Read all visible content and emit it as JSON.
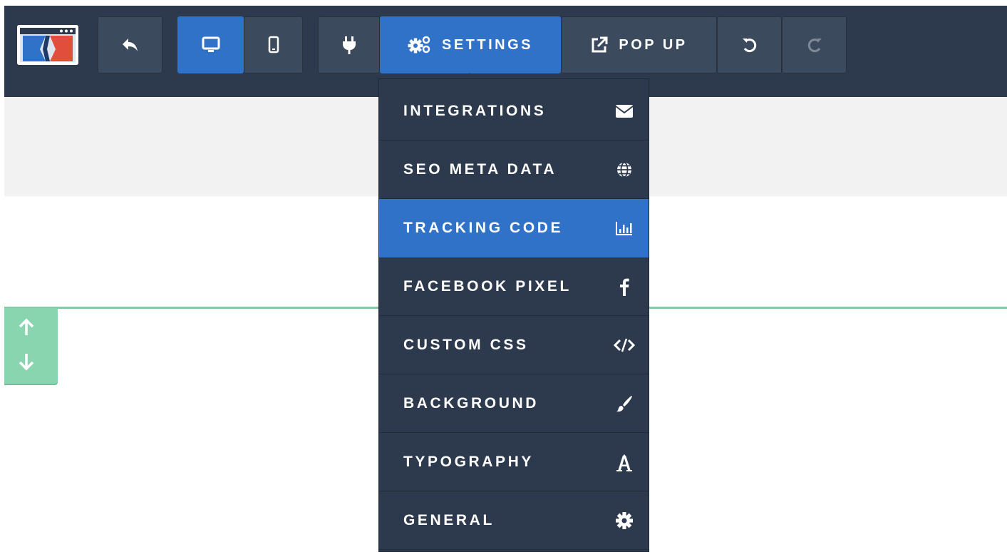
{
  "toolbar": {
    "settings_label": "SETTINGS",
    "popup_label": "POP UP"
  },
  "settings_menu": {
    "items": [
      {
        "label": "INTEGRATIONS",
        "icon": "envelope-icon"
      },
      {
        "label": "SEO META DATA",
        "icon": "globe-icon"
      },
      {
        "label": "TRACKING CODE",
        "icon": "bar-chart-icon",
        "active": true
      },
      {
        "label": "FACEBOOK PIXEL",
        "icon": "facebook-icon"
      },
      {
        "label": "CUSTOM CSS",
        "icon": "code-icon"
      },
      {
        "label": "BACKGROUND",
        "icon": "paintbrush-icon"
      },
      {
        "label": "TYPOGRAPHY",
        "icon": "font-icon"
      },
      {
        "label": "GENERAL",
        "icon": "gear-icon"
      }
    ]
  },
  "colors": {
    "toolbar_bg": "#2d3a4d",
    "button_bg": "#3c4a5e",
    "accent_blue": "#2f72c7",
    "section_green": "#88d5b0",
    "canvas_grey": "#f2f2f2"
  }
}
